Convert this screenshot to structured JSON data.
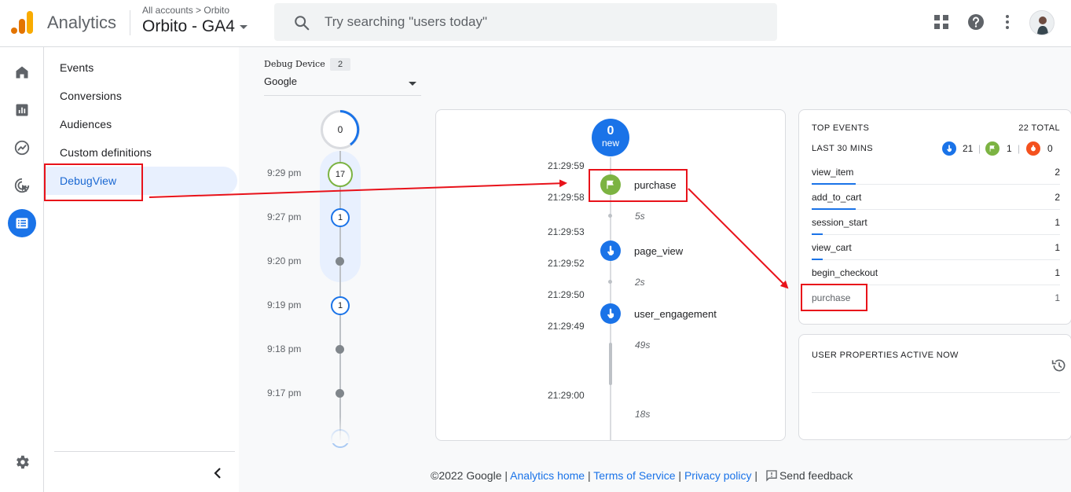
{
  "header": {
    "brand": "Analytics",
    "breadcrumb": "All accounts > Orbito",
    "property": "Orbito - GA4",
    "search_placeholder": "Try searching \"users today\""
  },
  "icons": {
    "logo": "analytics-logo-icon",
    "search": "search-icon",
    "apps": "apps-grid-icon",
    "help": "help-icon",
    "more": "more-vert-icon",
    "home": "home-icon",
    "reports": "reports-icon",
    "explore": "explore-icon",
    "advertising": "advertising-icon",
    "configure": "configure-icon",
    "settings": "settings-icon"
  },
  "nav": {
    "items": [
      {
        "label": "Events"
      },
      {
        "label": "Conversions"
      },
      {
        "label": "Audiences"
      },
      {
        "label": "Custom definitions"
      },
      {
        "label": "DebugView",
        "active": true
      }
    ]
  },
  "device": {
    "label": "Debug Device",
    "count": "2",
    "selected": "Google"
  },
  "minutes": {
    "top_count": "0",
    "rows": [
      {
        "time": "9:29 pm",
        "count": "17"
      },
      {
        "time": "9:27 pm",
        "count": "1"
      },
      {
        "time": "9:20 pm",
        "count": ""
      },
      {
        "time": "9:19 pm",
        "count": "1"
      },
      {
        "time": "9:18 pm",
        "count": ""
      },
      {
        "time": "9:17 pm",
        "count": ""
      }
    ]
  },
  "seconds": {
    "badge_count": "0",
    "badge_text": "new",
    "timestamps": [
      "21:29:59",
      "21:29:58",
      "21:29:53",
      "21:29:52",
      "21:29:50",
      "21:29:49",
      "21:29:00"
    ],
    "durations": [
      "5s",
      "2s",
      "49s",
      "18s"
    ],
    "events": [
      {
        "name": "purchase",
        "type": "conversion"
      },
      {
        "name": "page_view",
        "type": "event"
      },
      {
        "name": "user_engagement",
        "type": "event"
      }
    ]
  },
  "top_events": {
    "title": "TOP EVENTS",
    "total": "22 TOTAL",
    "period": "LAST 30 MINS",
    "counts": {
      "events": "21",
      "conversions": "1",
      "errors": "0"
    },
    "rows": [
      {
        "name": "view_item",
        "count": "2"
      },
      {
        "name": "add_to_cart",
        "count": "2"
      },
      {
        "name": "session_start",
        "count": "1"
      },
      {
        "name": "view_cart",
        "count": "1"
      },
      {
        "name": "begin_checkout",
        "count": "1"
      },
      {
        "name": "purchase",
        "count": "1"
      }
    ]
  },
  "user_properties": {
    "title": "USER PROPERTIES ACTIVE NOW"
  },
  "footer": {
    "copyright": "©2022 Google",
    "analytics_home": "Analytics home",
    "terms": "Terms of Service",
    "privacy": "Privacy policy",
    "feedback": "Send feedback",
    "sep": "|"
  },
  "colors": {
    "accent": "#1a73e8",
    "conversion": "#7cb342",
    "error": "#f4511e",
    "annotation": "#e8121a"
  }
}
